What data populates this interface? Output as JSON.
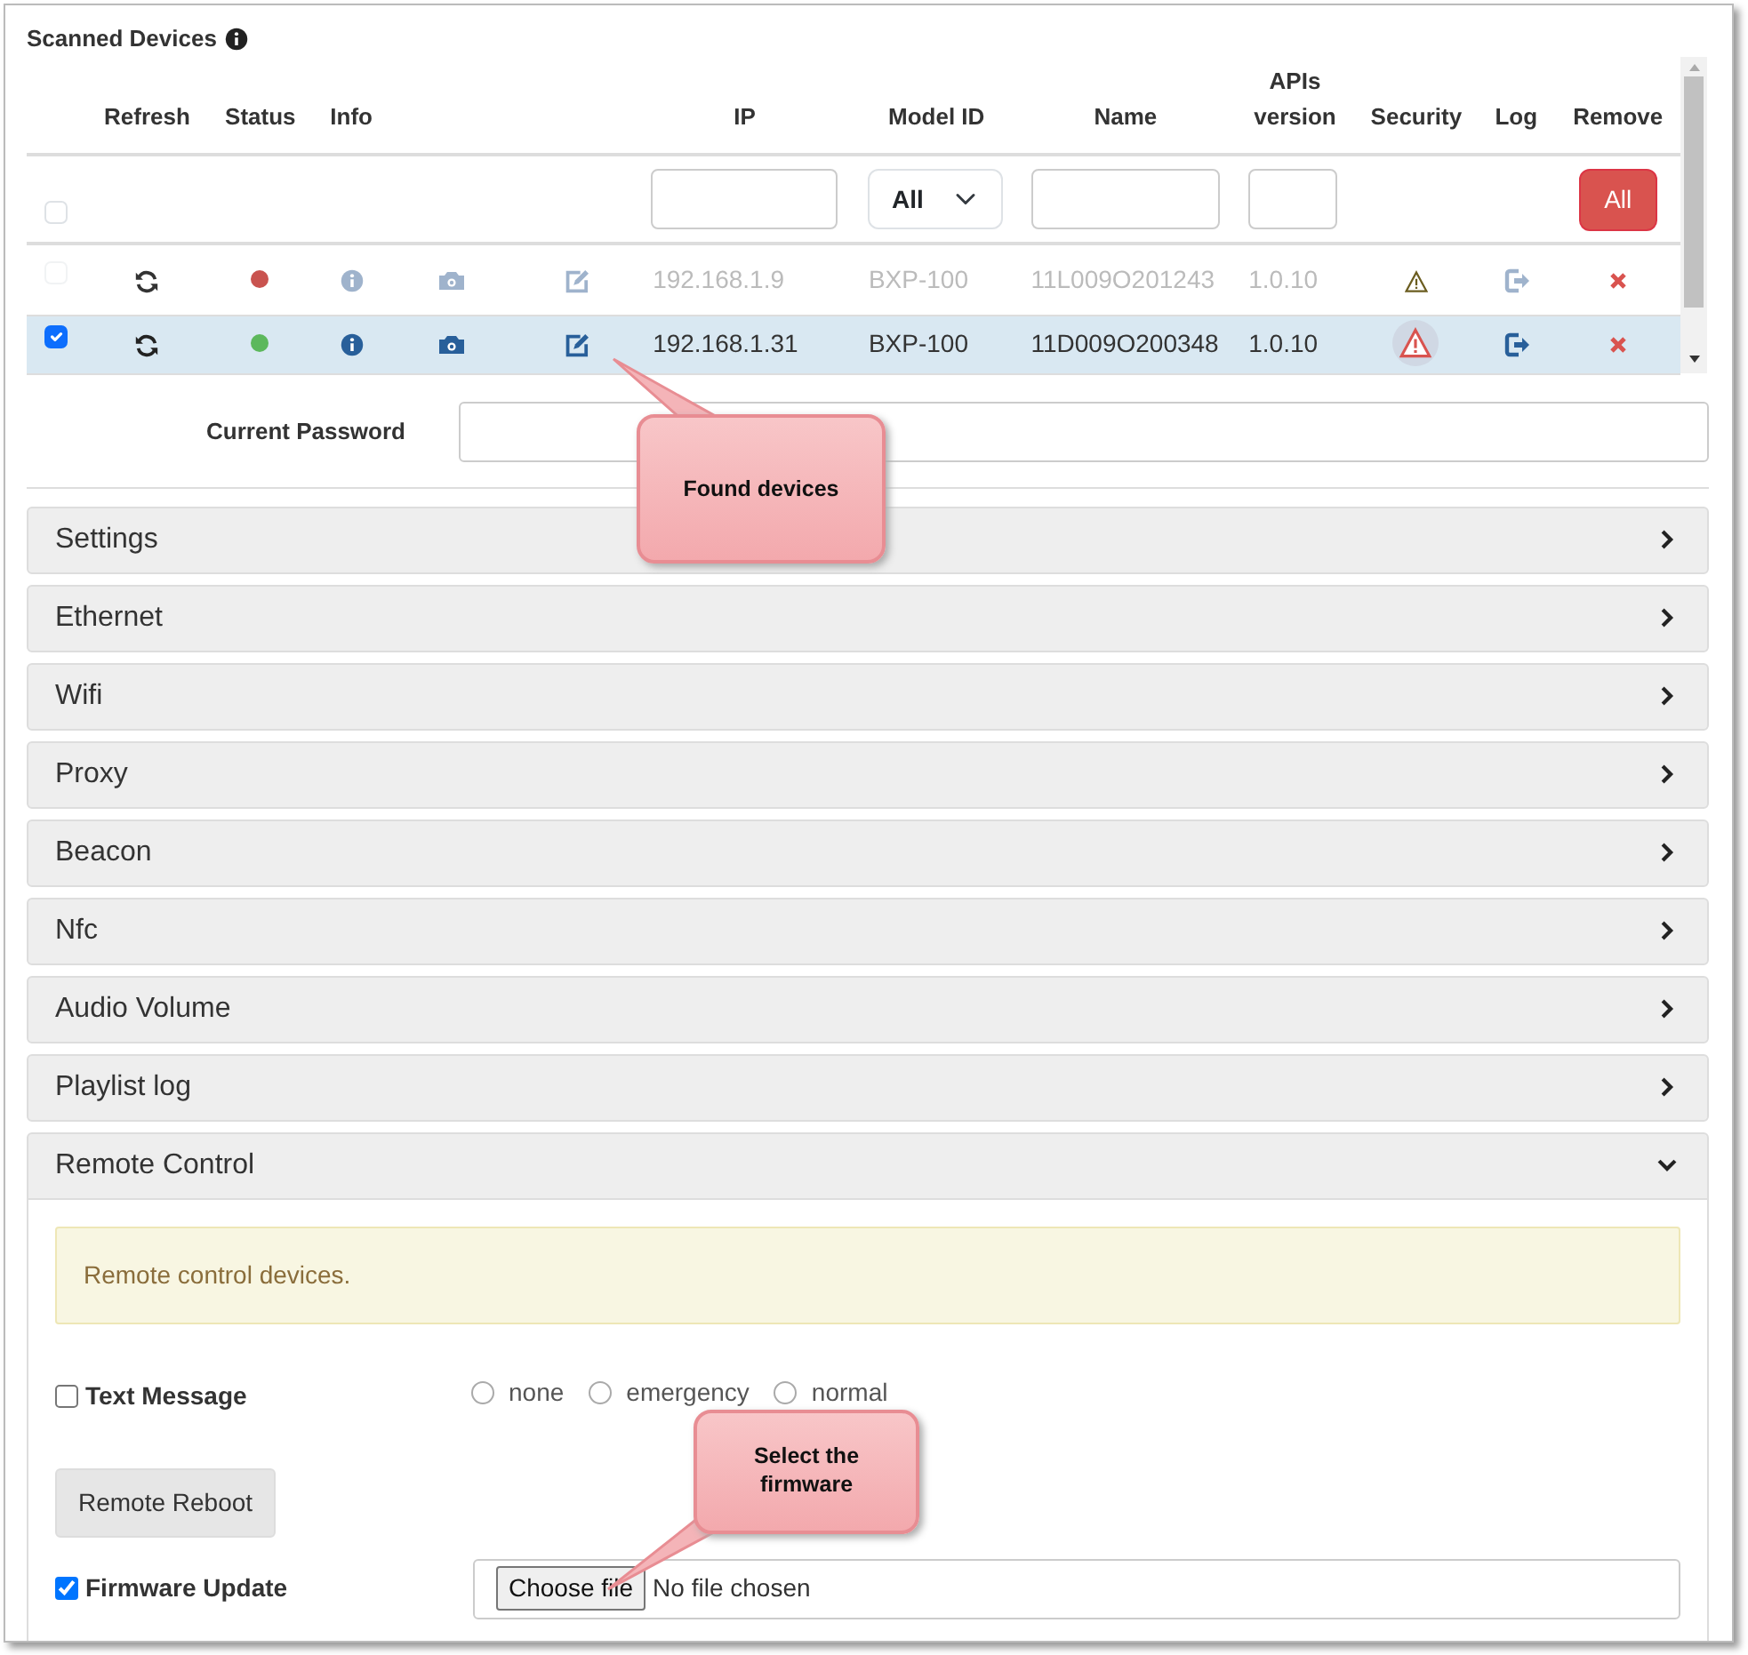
{
  "panel_title": "Scanned Devices",
  "columns": [
    "",
    "Refresh",
    "Status",
    "Info",
    "",
    "",
    "IP",
    "Model ID",
    "Name",
    "APIs version",
    "Security",
    "Log",
    "Remove"
  ],
  "filters": {
    "select_all_checked": false,
    "model_options_shown": "All",
    "remove_all": "All"
  },
  "devices": [
    {
      "selected": false,
      "disabled": true,
      "color": "#c9534f",
      "ip": "192.168.1.9",
      "model": "BXP-100",
      "name": "11L009O201243",
      "api": "1.0.10",
      "security_highlighted": false
    },
    {
      "selected": true,
      "disabled": false,
      "color": "#5cb85c",
      "ip": "192.168.1.31",
      "model": "BXP-100",
      "name": "11D009O200348",
      "api": "1.0.10",
      "security_highlighted": true
    }
  ],
  "password_label": "Current Password",
  "sections": [
    {
      "title": "Settings",
      "expanded": false
    },
    {
      "title": "Ethernet",
      "expanded": false
    },
    {
      "title": "Wifi",
      "expanded": false
    },
    {
      "title": "Proxy",
      "expanded": false
    },
    {
      "title": "Beacon",
      "expanded": false
    },
    {
      "title": "Nfc",
      "expanded": false
    },
    {
      "title": "Audio Volume",
      "expanded": false
    },
    {
      "title": "Playlist log",
      "expanded": false
    },
    {
      "title": "Remote Control",
      "expanded": true
    }
  ],
  "remote_control": {
    "note": "Remote control devices.",
    "text_message": {
      "label": "Text Message",
      "checked": false
    },
    "modes": [
      {
        "label": "none",
        "selected": false
      },
      {
        "label": "emergency",
        "selected": false
      },
      {
        "label": "normal",
        "selected": false
      }
    ],
    "reboot_button": "Remote Reboot",
    "firmware": {
      "label": "Firmware Update",
      "checked": true,
      "choose_button": "Choose file",
      "file_status": "No file chosen"
    }
  },
  "callouts": [
    {
      "text": "Found devices"
    },
    {
      "text": "Select the firmware"
    }
  ]
}
